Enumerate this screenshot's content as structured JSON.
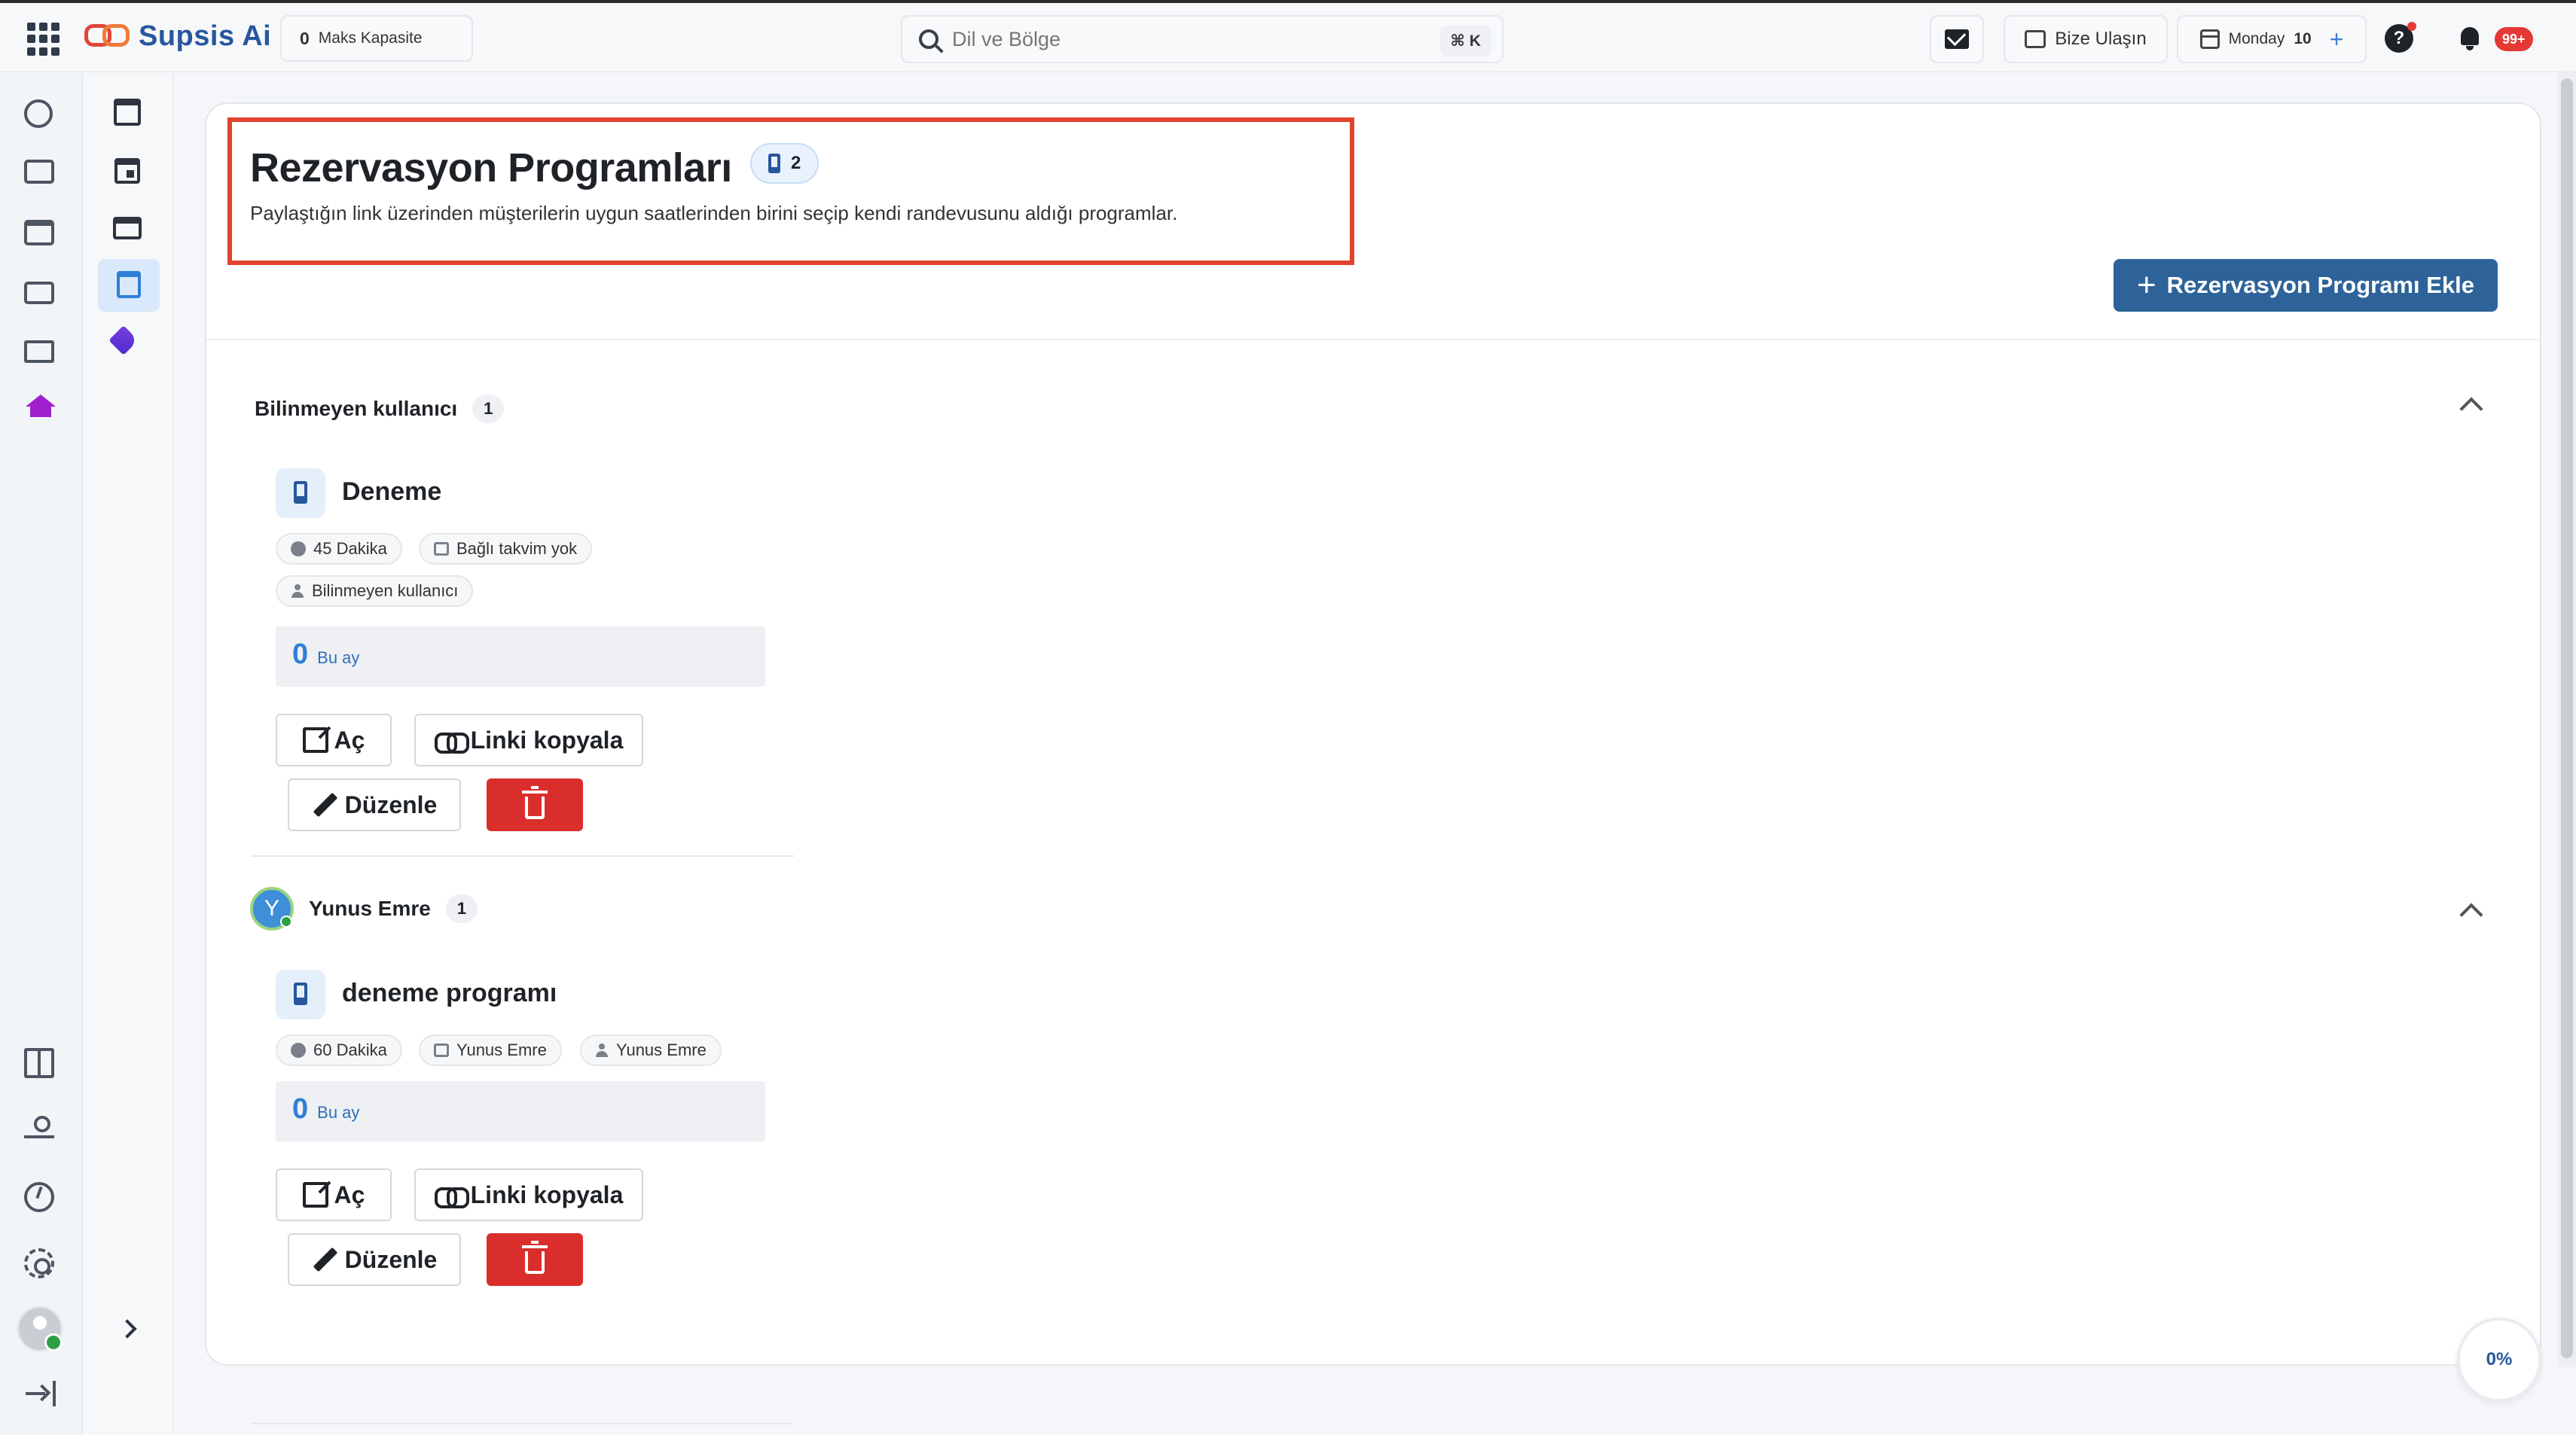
{
  "app": {
    "name": "Supsis Ai"
  },
  "topbar": {
    "capacity_value": "0",
    "capacity_label": "Maks Kapasite",
    "search_placeholder": "Dil ve Bölge",
    "search_shortcut": "⌘ K",
    "contact_label": "Bize Ulaşın",
    "calendar_day": "Monday",
    "calendar_date": "10",
    "help_label": "?",
    "notifications_badge": "99+"
  },
  "page": {
    "title": "Rezervasyon Programları",
    "count": "2",
    "description": "Paylaştığın link üzerinden müşterilerin uygun saatlerinden birini seçip kendi randevusunu aldığı programlar.",
    "add_button": "Rezervasyon Programı Ekle",
    "add_button_icon": "+"
  },
  "groups": [
    {
      "owner": "Bilinmeyen kullanıcı",
      "count": "1",
      "program": {
        "name": "Deneme",
        "duration": "45 Dakika",
        "calendar": "Bağlı takvim yok",
        "user": "Bilinmeyen kullanıcı",
        "stat_value": "0",
        "stat_label": "Bu ay"
      }
    },
    {
      "owner": "Yunus Emre",
      "owner_initial": "Y",
      "count": "1",
      "program": {
        "name": "deneme programı",
        "duration": "60 Dakika",
        "calendar": "Yunus Emre",
        "user": "Yunus Emre",
        "stat_value": "0",
        "stat_label": "Bu ay"
      }
    }
  ],
  "actions": {
    "open": "Aç",
    "copy_link": "Linki kopyala",
    "edit": "Düzenle"
  },
  "progress": "0%",
  "colors": {
    "primary": "#2d6399",
    "brand": "#27579d",
    "danger": "#d92e2b",
    "highlight_border": "#e1432f",
    "accent_blue": "#2f7fd6"
  }
}
